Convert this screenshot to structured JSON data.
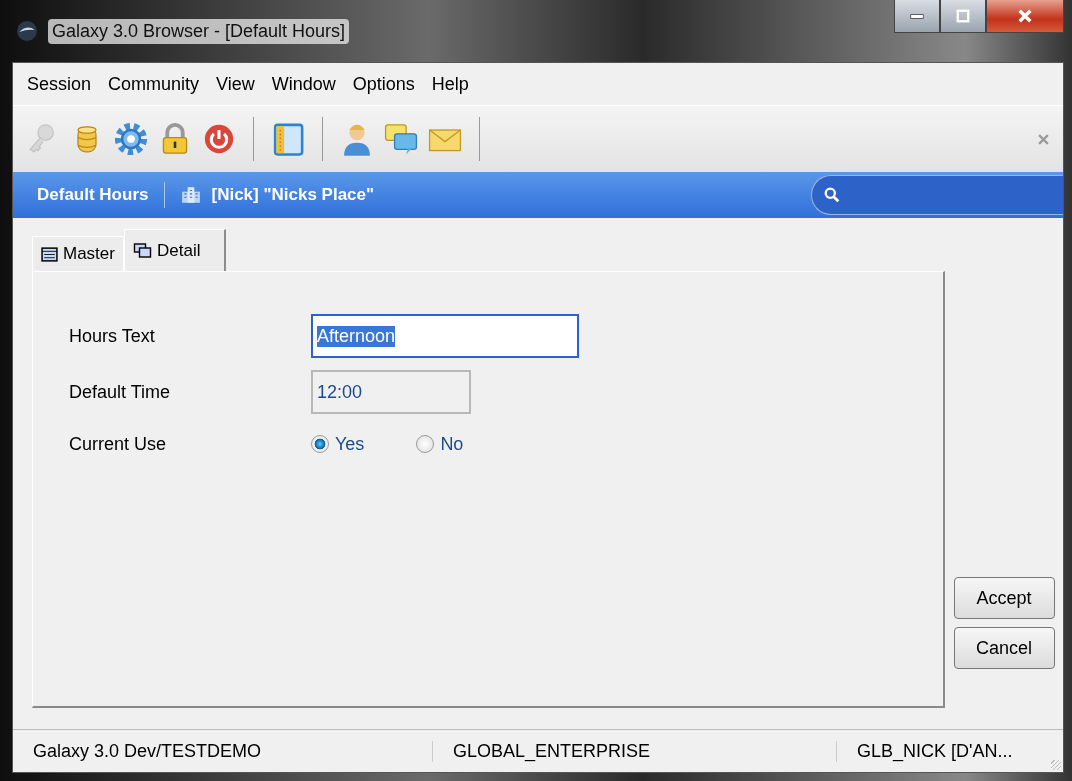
{
  "window": {
    "title": "Galaxy 3.0 Browser - [Default Hours]"
  },
  "menu": [
    "Session",
    "Community",
    "View",
    "Window",
    "Options",
    "Help"
  ],
  "toolbar": [
    {
      "kind": "key",
      "disabled": true
    },
    {
      "kind": "database",
      "disabled": false
    },
    {
      "kind": "gear",
      "disabled": false
    },
    {
      "kind": "lock",
      "disabled": false
    },
    {
      "kind": "power",
      "disabled": false
    },
    {
      "kind": "separator"
    },
    {
      "kind": "panel",
      "disabled": false
    },
    {
      "kind": "separator"
    },
    {
      "kind": "person",
      "disabled": false
    },
    {
      "kind": "chat",
      "disabled": false
    },
    {
      "kind": "mail",
      "disabled": false
    },
    {
      "kind": "separator"
    }
  ],
  "context_bar": {
    "title": "Default Hours",
    "location": "[Nick] \"Nicks Place\""
  },
  "tabs": [
    {
      "label": "Master",
      "selected": false
    },
    {
      "label": "Detail",
      "selected": true
    }
  ],
  "fields": [
    {
      "kind": "text",
      "label": "Hours Text",
      "value": "Afternoon",
      "focused": true
    },
    {
      "kind": "time",
      "label": "Default Time",
      "value": "12:00",
      "focused": false
    },
    {
      "kind": "radio",
      "label": "Current Use",
      "options": [
        {
          "label": "Yes",
          "selected": true
        },
        {
          "label": "No",
          "selected": false
        }
      ]
    }
  ],
  "buttons": [
    "Accept",
    "Cancel"
  ],
  "status_bar": [
    "Galaxy 3.0 Dev/TESTDEMO",
    "GLOBAL_ENTERPRISE",
    "GLB_NICK [D'AN..."
  ]
}
